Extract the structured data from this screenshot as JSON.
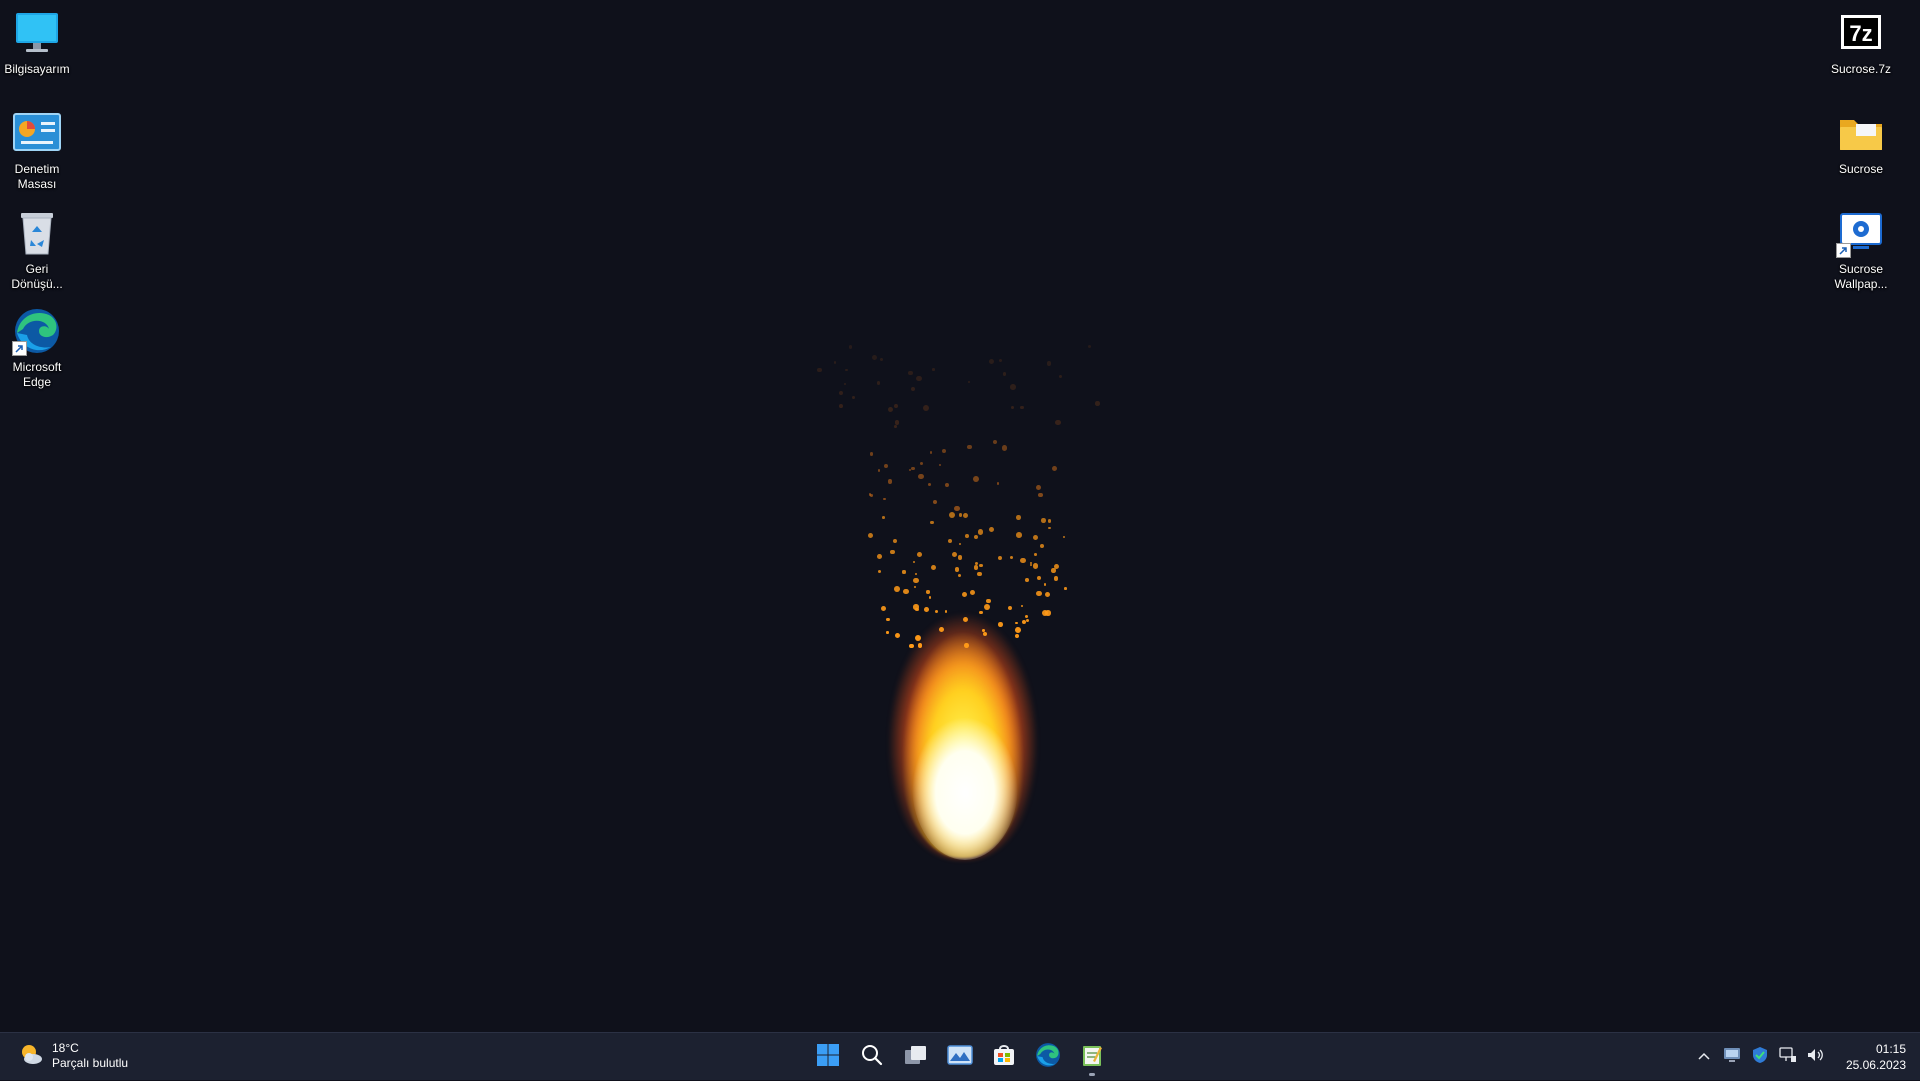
{
  "desktop": {
    "left_icons": [
      {
        "label": "Bilgisayarım",
        "icon": "monitor-icon"
      },
      {
        "label": "Denetim\nMasası",
        "icon": "control-panel-icon"
      },
      {
        "label": "Geri\nDönüşü...",
        "icon": "recycle-bin-icon"
      },
      {
        "label": "Microsoft\nEdge",
        "icon": "edge-icon"
      }
    ],
    "right_icons": [
      {
        "label": "Sucrose.7z",
        "icon": "7z-archive-icon"
      },
      {
        "label": "Sucrose",
        "icon": "folder-icon"
      },
      {
        "label": "Sucrose\nWallpap...",
        "icon": "sucrose-wallpaper-icon"
      }
    ],
    "wallpaper": "animated-fire"
  },
  "taskbar": {
    "weather": {
      "temp": "18°C",
      "condition": "Parçalı bulutlu"
    },
    "pinned": [
      {
        "name": "start",
        "icon": "windows-start-icon"
      },
      {
        "name": "search",
        "icon": "search-icon"
      },
      {
        "name": "task-view",
        "icon": "task-view-icon"
      },
      {
        "name": "photos",
        "icon": "photos-icon"
      },
      {
        "name": "store",
        "icon": "store-icon"
      },
      {
        "name": "edge",
        "icon": "edge-icon"
      },
      {
        "name": "notepad-app",
        "icon": "notepad-icon"
      }
    ],
    "tray": {
      "icons": [
        "chevron-up-icon",
        "display-icon",
        "security-shield-icon",
        "network-icon",
        "volume-icon"
      ],
      "time": "01:15",
      "date": "25.06.2023"
    }
  },
  "colors": {
    "desktop_bg": "#0f111b",
    "taskbar_bg": "#1c2130",
    "accent": "#3b9ef5"
  }
}
